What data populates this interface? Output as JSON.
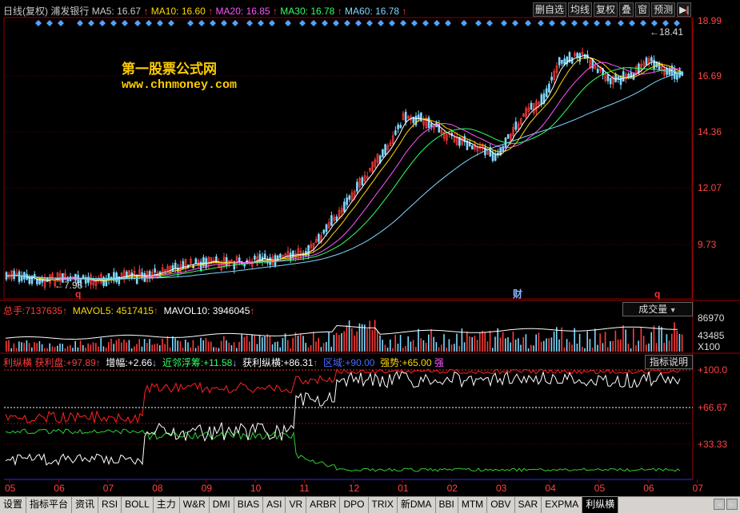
{
  "header": {
    "period": "日线(复权)",
    "stock_name": "浦发银行",
    "ma": [
      {
        "label": "MA5:",
        "value": "16.67",
        "arrow": "↑",
        "color": "#ffffff"
      },
      {
        "label": "MA10:",
        "value": "16.60",
        "arrow": "↑",
        "color": "#ffd800"
      },
      {
        "label": "MA20:",
        "value": "16.85",
        "arrow": "↑",
        "color": "#ff55ff"
      },
      {
        "label": "MA30:",
        "value": "16.78",
        "arrow": "↑",
        "color": "#33ff66"
      },
      {
        "label": "MA60:",
        "value": "16.78",
        "arrow": "↑",
        "color": "#7fd8ff"
      }
    ],
    "buttons": [
      "删自选",
      "均线",
      "复权",
      "叠",
      "窗",
      "预测"
    ],
    "nav_icon": "▶|",
    "down_arrow": "↓"
  },
  "watermark": {
    "name": "第一股票公式网",
    "url": "www.chnmoney.com"
  },
  "price_panel": {
    "y_ticks": [
      "18.99",
      "16.69",
      "14.36",
      "12.07",
      "9.73"
    ],
    "max_label": "18.41",
    "min_label": "7.98",
    "markers": [
      "q",
      "q",
      "财"
    ]
  },
  "volume_panel": {
    "title_label": "总手:",
    "title_value": "7137635",
    "mavol5_label": "MAVOL5:",
    "mavol5_value": "4517415",
    "mavol10_label": "MAVOL10:",
    "mavol10_value": "3946045",
    "up": "↑",
    "dropdown": "成交量",
    "y_ticks": [
      "86970",
      "43485",
      "X100"
    ]
  },
  "indicator_panel": {
    "name": "利纵横",
    "items": [
      {
        "label": "获利盘:",
        "value": "+97.89",
        "arrow": "↑",
        "color": "#ff3b3b"
      },
      {
        "label": "增幅:",
        "value": "+2.66",
        "arrow": "↓",
        "color": "#ffffff"
      },
      {
        "label": "近邻浮筹:",
        "value": "+11.58",
        "arrow": "↓",
        "color": "#33ff66"
      },
      {
        "label": "获利纵横:",
        "value": "+86.31",
        "arrow": "↑",
        "color": "#ffffff"
      },
      {
        "label": "区域:",
        "value": "+90.00",
        "arrow": "",
        "color": "#4a6bff"
      },
      {
        "label": "强势:",
        "value": "+65.00",
        "arrow": "",
        "color": "#ffd800"
      },
      {
        "label": "强",
        "value": "",
        "arrow": "",
        "color": "#ff55ff"
      }
    ],
    "help_button": "指标说明",
    "y_ticks": [
      "+100.0",
      "+66.67",
      "+33.33"
    ]
  },
  "x_axis": [
    "05",
    "06",
    "07",
    "08",
    "09",
    "10",
    "11",
    "12",
    "01",
    "02",
    "03",
    "04",
    "05",
    "06",
    "07"
  ],
  "tabs": [
    "设置",
    "指标平台",
    "资讯",
    "RSI",
    "BOLL",
    "主力",
    "W&R",
    "DMI",
    "BIAS",
    "ASI",
    "VR",
    "ARBR",
    "DPO",
    "TRIX",
    "新DMA",
    "BBI",
    "MTM",
    "OBV",
    "SAR",
    "EXPMA",
    "利纵横"
  ],
  "active_tab": "利纵横",
  "colors": {
    "up": "#ff3b3b",
    "down": "#7fd8ff",
    "grid": "#7a0000",
    "axis": "#a00000"
  }
}
